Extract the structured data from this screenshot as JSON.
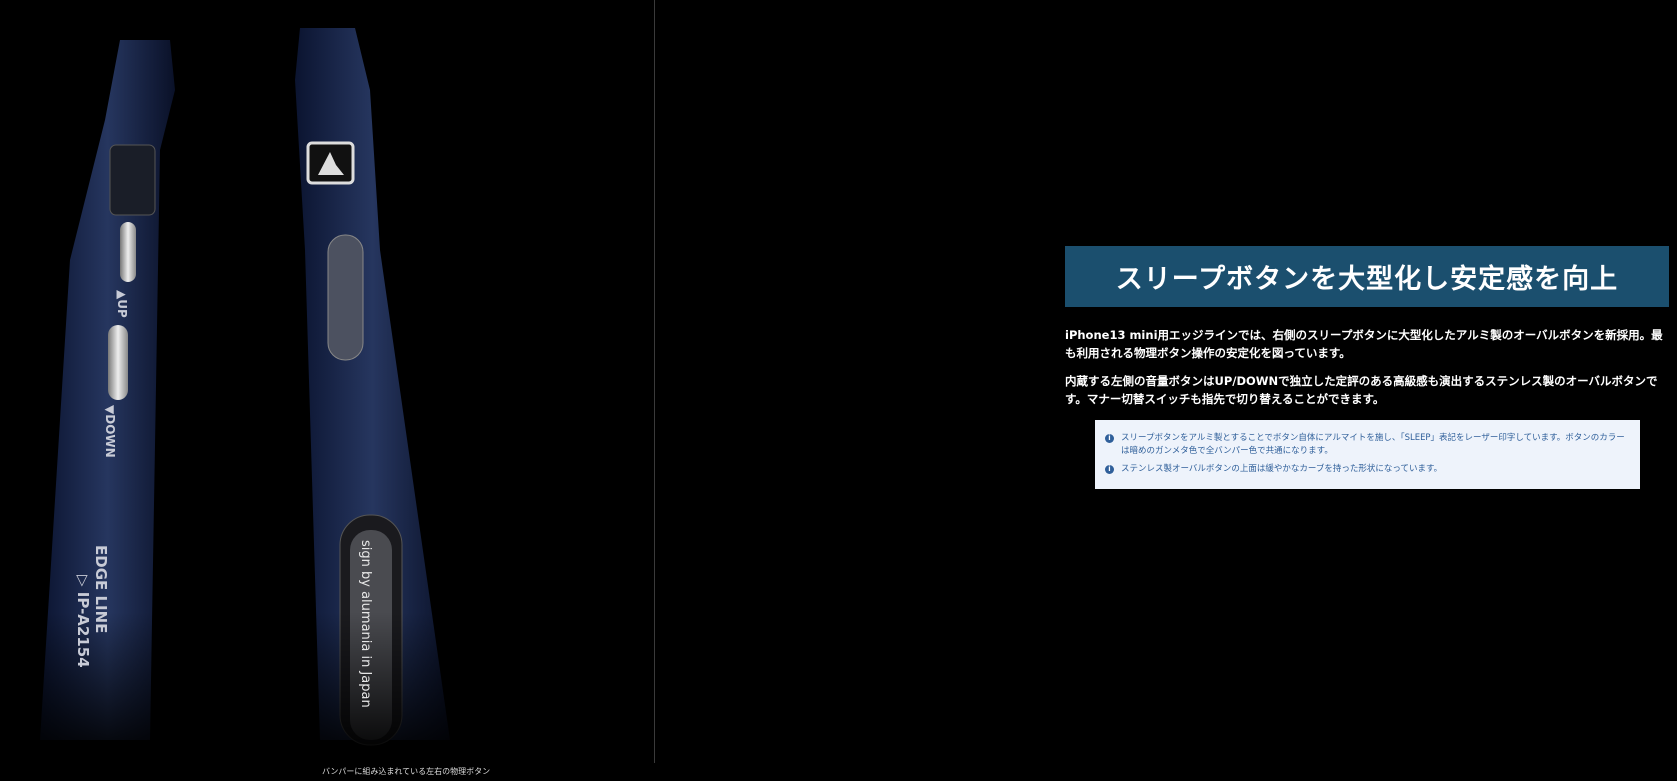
{
  "photo": {
    "caption": "バンパーに組み込まれている左右の物理ボタン",
    "left_labels": [
      "▲UP",
      "▼DOWN",
      "EDGE LINE",
      "▷ IP-A2154"
    ],
    "right_label": "sign by alumania in Japan"
  },
  "heading": "スリープボタンを大型化し安定感を向上",
  "paragraphs": [
    "iPhone13 mini用エッジラインでは、右側のスリープボタンに大型化したアルミ製のオーバルボタンを新採用。最も利用される物理ボタン操作の安定化を図っています。",
    "内蔵する左側の音量ボタンはUP/DOWNで独立した定評のある高級感も演出するステンレス製のオーバルボタンです。マナー切替スイッチも指先で切り替えることができます。"
  ],
  "notes": [
    "スリープボタンをアルミ製とすることでボタン自体にアルマイトを施し、「SLEEP」表記をレーザー印字しています。ボタンのカラーは暗めのガンメタ色で全バンパー色で共通になります。",
    "ステンレス製オーバルボタンの上面は緩やかなカーブを持った形状になっています。"
  ],
  "colors": {
    "heading_bg": "#1b4f6e",
    "note_bg": "#eef3fb",
    "note_text": "#2f5f9a"
  }
}
